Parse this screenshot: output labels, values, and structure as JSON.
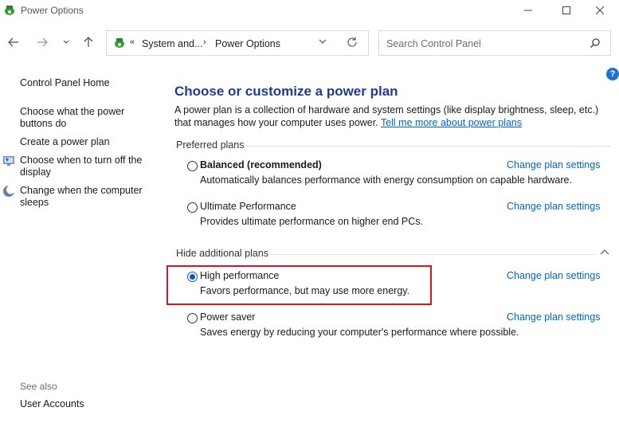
{
  "window": {
    "title": "Power Options",
    "icon": "power-options-app-icon",
    "controls": [
      "minimize-icon",
      "maximize-icon",
      "close-icon"
    ]
  },
  "navigation": {
    "back_icon": "arrow-left-icon",
    "forward_icon": "arrow-right-icon",
    "recent_icon": "chevron-down-icon",
    "up_icon": "arrow-up-icon"
  },
  "address_bar": {
    "separator": "«",
    "crumb_separator": "›",
    "crumbs": [
      "System and...",
      "Power Options"
    ],
    "dropdown_icon": "chevron-down-icon",
    "refresh_icon": "refresh-icon"
  },
  "search": {
    "placeholder": "Search Control Panel",
    "icon": "search-icon"
  },
  "help": {
    "label": "?"
  },
  "sidebar": {
    "home": "Control Panel Home",
    "links": [
      {
        "label": "Choose what the power buttons do",
        "icon": null
      },
      {
        "label": "Create a power plan",
        "icon": null
      },
      {
        "label": "Choose when to turn off the display",
        "icon": "monitor-shield-icon"
      },
      {
        "label": "Change when the computer sleeps",
        "icon": "moon-icon"
      }
    ],
    "see_also_heading": "See also",
    "see_also_links": [
      "User Accounts"
    ]
  },
  "main": {
    "title": "Choose or customize a power plan",
    "description": "A power plan is a collection of hardware and system settings (like display brightness, sleep, etc.) that manages how your computer uses power.",
    "description_link": "Tell me more about power plans",
    "preferred_header": "Preferred plans",
    "additional_header": "Hide additional plans",
    "change_link": "Change plan settings",
    "preferred_plans": [
      {
        "name": "Balanced (recommended)",
        "description": "Automatically balances performance with energy consumption on capable hardware.",
        "selected": false
      },
      {
        "name": "Ultimate Performance",
        "description": "Provides ultimate performance on higher end PCs.",
        "selected": false
      }
    ],
    "additional_plans": [
      {
        "name": "High performance",
        "description": "Favors performance, but may use more energy.",
        "selected": true
      },
      {
        "name": "Power saver",
        "description": "Saves energy by reducing your computer's performance where possible.",
        "selected": false
      }
    ]
  },
  "colors": {
    "title_blue": "#1e3d8a",
    "link_blue": "#0066cc",
    "highlight_red": "#d9161c",
    "radio_selected": "#0a5bbf"
  }
}
